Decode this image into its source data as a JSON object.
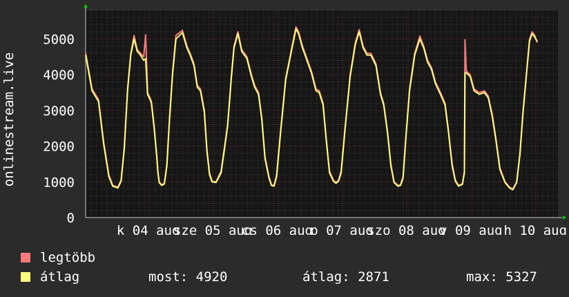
{
  "chart_data": {
    "type": "line",
    "ylabel": "onlinestream.live",
    "ylim": [
      0,
      5800
    ],
    "yticks": [
      0,
      1000,
      2000,
      3000,
      4000,
      5000
    ],
    "ytick_labels": [
      "0",
      "1000",
      "2000",
      "3000",
      "4000",
      "5000"
    ],
    "x_range_days": [
      0,
      7.32
    ],
    "xtick_days": [
      0.97,
      1.97,
      2.97,
      3.97,
      4.97,
      5.97,
      6.97
    ],
    "xtick_labels": [
      "k 04 aug",
      "sze 05 aug",
      "cs 06 aug",
      "p 07 aug",
      "szo 08 aug",
      "v 09 aug",
      "h 10 aug"
    ],
    "grid": true,
    "series": [
      {
        "name": "legtöbb",
        "color": "#ff7b7b",
        "x": [
          0,
          0.1,
          0.2,
          0.28,
          0.36,
          0.42,
          0.5,
          0.55,
          0.6,
          0.65,
          0.7,
          0.75,
          0.8,
          0.85,
          0.9,
          0.93,
          0.96,
          1.0,
          1.02,
          1.06,
          1.1,
          1.12,
          1.14,
          1.18,
          1.22,
          1.26,
          1.3,
          1.35,
          1.4,
          1.5,
          1.57,
          1.62,
          1.68,
          1.73,
          1.78,
          1.84,
          1.88,
          1.92,
          1.96,
          2.02,
          2.1,
          2.2,
          2.26,
          2.3,
          2.36,
          2.42,
          2.5,
          2.57,
          2.62,
          2.68,
          2.73,
          2.78,
          2.84,
          2.88,
          2.92,
          2.96,
          3.02,
          3.1,
          3.2,
          3.26,
          3.3,
          3.36,
          3.42,
          3.5,
          3.57,
          3.62,
          3.68,
          3.73,
          3.78,
          3.84,
          3.88,
          3.92,
          3.96,
          4.02,
          4.1,
          4.18,
          4.24,
          4.3,
          4.36,
          4.42,
          4.5,
          4.57,
          4.62,
          4.68,
          4.73,
          4.78,
          4.84,
          4.88,
          4.92,
          4.96,
          5.02,
          5.1,
          5.18,
          5.24,
          5.3,
          5.36,
          5.42,
          5.5,
          5.57,
          5.62,
          5.68,
          5.73,
          5.78,
          5.84,
          5.87,
          5.88,
          5.9,
          5.96,
          6.02,
          6.1,
          6.18,
          6.24,
          6.3,
          6.36,
          6.42,
          6.5,
          6.57,
          6.62,
          6.68,
          6.73,
          6.78,
          6.84,
          6.88,
          6.92,
          6.96,
          7.0
        ],
        "y": [
          4620,
          3600,
          3300,
          2100,
          1200,
          900,
          850,
          1050,
          2000,
          3600,
          4600,
          5100,
          4700,
          4600,
          4500,
          5120,
          3500,
          3350,
          3250,
          2600,
          1800,
          1300,
          1000,
          920,
          960,
          1500,
          2800,
          4100,
          5100,
          5240,
          4800,
          4600,
          4300,
          3700,
          3600,
          3000,
          1900,
          1250,
          1020,
          1000,
          1300,
          2600,
          4000,
          4800,
          5200,
          4700,
          4500,
          4000,
          3700,
          3500,
          2800,
          1700,
          1150,
          920,
          900,
          1200,
          2400,
          3900,
          4800,
          5340,
          5200,
          4800,
          4500,
          4100,
          3600,
          3550,
          3200,
          2200,
          1300,
          1050,
          980,
          1050,
          1300,
          2500,
          4000,
          4900,
          5260,
          4800,
          4600,
          4600,
          4300,
          3500,
          3200,
          2400,
          1500,
          1000,
          900,
          920,
          1150,
          2200,
          3600,
          4600,
          5080,
          4800,
          4400,
          4200,
          3800,
          3500,
          3200,
          2500,
          1500,
          1050,
          900,
          950,
          1300,
          4980,
          4100,
          4000,
          3600,
          3500,
          3550,
          3400,
          2900,
          2200,
          1400,
          1000,
          850,
          800,
          1000,
          1800,
          3000,
          4200,
          5000,
          5200,
          5100,
          4900
        ]
      },
      {
        "name": "átlag",
        "color": "#ffff80",
        "x": [
          0,
          0.1,
          0.2,
          0.28,
          0.36,
          0.42,
          0.5,
          0.55,
          0.6,
          0.65,
          0.7,
          0.75,
          0.8,
          0.85,
          0.9,
          0.93,
          0.96,
          1.0,
          1.02,
          1.06,
          1.1,
          1.12,
          1.14,
          1.18,
          1.22,
          1.26,
          1.3,
          1.35,
          1.4,
          1.5,
          1.57,
          1.62,
          1.68,
          1.73,
          1.78,
          1.84,
          1.88,
          1.92,
          1.96,
          2.02,
          2.1,
          2.2,
          2.26,
          2.3,
          2.36,
          2.42,
          2.5,
          2.57,
          2.62,
          2.68,
          2.73,
          2.78,
          2.84,
          2.88,
          2.92,
          2.96,
          3.02,
          3.1,
          3.2,
          3.26,
          3.3,
          3.36,
          3.42,
          3.5,
          3.57,
          3.62,
          3.68,
          3.73,
          3.78,
          3.84,
          3.88,
          3.92,
          3.96,
          4.02,
          4.1,
          4.18,
          4.24,
          4.3,
          4.36,
          4.42,
          4.5,
          4.57,
          4.62,
          4.68,
          4.73,
          4.78,
          4.84,
          4.88,
          4.92,
          4.96,
          5.02,
          5.1,
          5.18,
          5.24,
          5.3,
          5.36,
          5.42,
          5.5,
          5.57,
          5.62,
          5.68,
          5.73,
          5.78,
          5.84,
          5.87,
          5.88,
          5.9,
          5.96,
          6.02,
          6.1,
          6.18,
          6.24,
          6.3,
          6.36,
          6.42,
          6.5,
          6.57,
          6.62,
          6.68,
          6.73,
          6.78,
          6.84,
          6.88,
          6.92,
          6.96,
          7.0
        ],
        "y": [
          4550,
          3550,
          3250,
          2050,
          1150,
          880,
          830,
          1020,
          1950,
          3550,
          4550,
          5000,
          4650,
          4550,
          4400,
          4450,
          3450,
          3300,
          3200,
          2550,
          1750,
          1250,
          980,
          900,
          940,
          1450,
          2750,
          4050,
          5000,
          5180,
          4750,
          4550,
          4250,
          3650,
          3550,
          2950,
          1850,
          1200,
          1000,
          980,
          1250,
          2550,
          3950,
          4750,
          5150,
          4650,
          4450,
          3950,
          3650,
          3450,
          2750,
          1650,
          1120,
          900,
          880,
          1150,
          2350,
          3850,
          4750,
          5280,
          5150,
          4750,
          4450,
          4050,
          3550,
          3500,
          3150,
          2150,
          1250,
          1020,
          960,
          1020,
          1250,
          2450,
          3950,
          4850,
          5200,
          4750,
          4550,
          4550,
          4250,
          3450,
          3150,
          2350,
          1450,
          980,
          880,
          900,
          1100,
          2150,
          3550,
          4550,
          5000,
          4750,
          4350,
          4150,
          3750,
          3450,
          3150,
          2450,
          1450,
          1020,
          880,
          930,
          1250,
          4050,
          4050,
          3950,
          3550,
          3450,
          3500,
          3350,
          2850,
          2150,
          1350,
          980,
          830,
          780,
          980,
          1750,
          2950,
          4150,
          4950,
          5150,
          5050,
          4920
        ]
      }
    ]
  },
  "legend": [
    {
      "label": "legtöbb",
      "color": "#ff7b7b"
    },
    {
      "label": "átlag",
      "color": "#ffff80"
    }
  ],
  "stats": {
    "most": "most: 4920",
    "atlag": "átlag: 2871",
    "max": "max: 5327"
  },
  "colors": {
    "background": "#2b2b2b",
    "plot_background": "#161616",
    "grid_minor": "#3a3a3a",
    "grid_major": "#6a2a2a",
    "axis_arrow": "#00cc00"
  }
}
